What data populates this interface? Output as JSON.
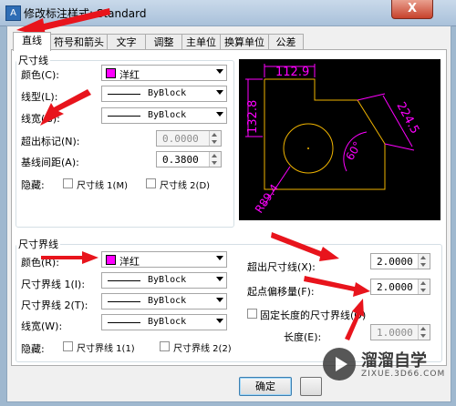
{
  "window": {
    "title": "修改标注样式: Standard",
    "app_icon": "A",
    "close_label": "X"
  },
  "tabs": [
    {
      "label": "直线"
    },
    {
      "label": "符号和箭头"
    },
    {
      "label": "文字"
    },
    {
      "label": "调整"
    },
    {
      "label": "主单位"
    },
    {
      "label": "换算单位"
    },
    {
      "label": "公差"
    }
  ],
  "dim_line": {
    "title": "尺寸线",
    "color_label": "颜色(C):",
    "color_value": "洋红",
    "color_hex": "#ff00ff",
    "linetype_label": "线型(L):",
    "linetype_value": "ByBlock",
    "lineweight_label": "线宽(G):",
    "lineweight_value": "ByBlock",
    "extend_ticks_label": "超出标记(N):",
    "extend_ticks_value": "0.0000",
    "baseline_spacing_label": "基线间距(A):",
    "baseline_spacing_value": "0.3800",
    "suppress_label": "隐藏:",
    "suppress_1": "尺寸线 1(M)",
    "suppress_2": "尺寸线 2(D)"
  },
  "ext_line": {
    "title": "尺寸界线",
    "color_label": "颜色(R):",
    "color_value": "洋红",
    "linetype1_label": "尺寸界线 1(I):",
    "linetype1_value": "ByBlock",
    "linetype2_label": "尺寸界线 2(T):",
    "linetype2_value": "ByBlock",
    "lineweight_label": "线宽(W):",
    "lineweight_value": "ByBlock",
    "suppress_label": "隐藏:",
    "suppress_1": "尺寸界线 1(1)",
    "suppress_2": "尺寸界线 2(2)",
    "extend_beyond_label": "超出尺寸线(X):",
    "extend_beyond_value": "2.0000",
    "offset_label": "起点偏移量(F):",
    "offset_value": "2.0000",
    "fixed_length_label": "固定长度的尺寸界线(O)",
    "length_label": "长度(E):",
    "length_value": "1.0000"
  },
  "preview": {
    "dim_top": "112.9",
    "dim_left": "132.8",
    "dim_right": "224.5",
    "dim_angle": "60°",
    "dim_radius": "R89.4"
  },
  "buttons": {
    "ok": "确定"
  },
  "watermark": {
    "text": "溜溜自学",
    "sub": "ZIXUE.3D66.COM"
  }
}
